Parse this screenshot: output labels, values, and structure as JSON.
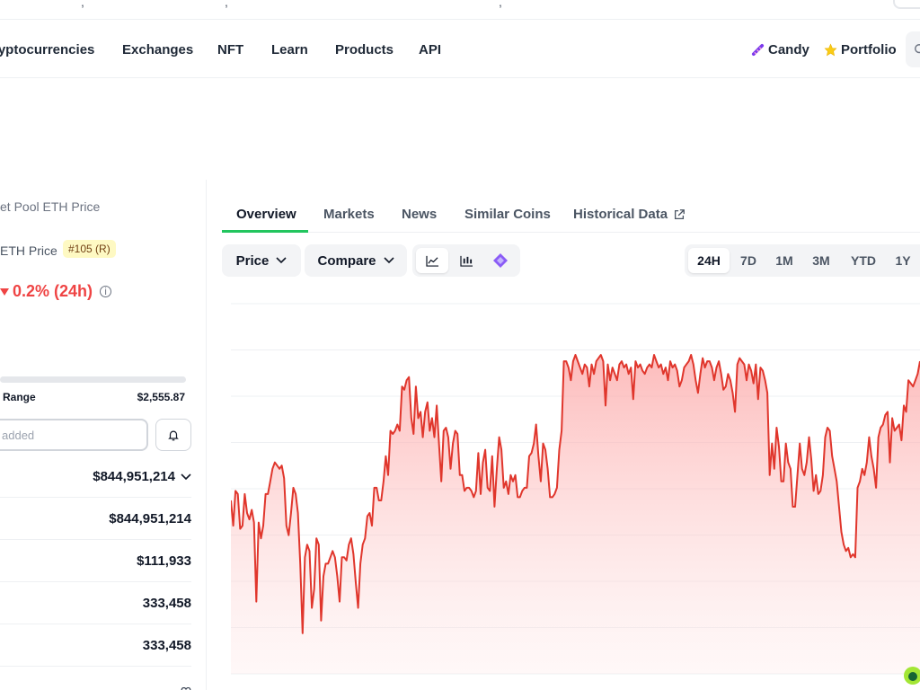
{
  "nav": {
    "items": [
      "ryptocurrencies",
      "Exchanges",
      "NFT",
      "Learn",
      "Products",
      "API"
    ],
    "candy": "Candy",
    "portfolio": "Portfolio"
  },
  "coin": {
    "title": "et Pool ETH Price",
    "price_label": "ETH Price",
    "rank": "#105 (R)",
    "change": "0.2% (24h)",
    "range_label": "Range",
    "range_value": "$2,555.87",
    "input_value": "added",
    "stats": [
      "$844,951,214",
      "$844,951,214",
      "$111,933",
      "333,458",
      "333,458"
    ]
  },
  "tabs": [
    "Overview",
    "Markets",
    "News",
    "Similar Coins",
    "Historical Data"
  ],
  "toolbar": {
    "price": "Price",
    "compare": "Compare"
  },
  "ranges": [
    "24H",
    "7D",
    "1M",
    "3M",
    "YTD",
    "1Y"
  ],
  "colors": {
    "accent_green": "#22c55e",
    "down_red": "#ef4444",
    "line_red": "#e0362c",
    "rank_bg": "#fef9c3"
  },
  "icons": {
    "candy": "candy-icon",
    "portfolio": "star-icon",
    "search": "search-icon",
    "bell": "bell-icon",
    "external": "external-link-icon",
    "chevron": "chevron-down-icon"
  },
  "chart_data": {
    "type": "area",
    "title": "",
    "xlabel": "",
    "ylabel": "",
    "grid": true,
    "ylim": [
      0,
      100
    ],
    "series": [
      {
        "values": [
          52,
          44,
          55,
          54,
          43,
          44,
          54,
          48,
          46,
          49,
          45,
          20,
          45,
          40,
          44,
          54,
          54,
          58,
          62,
          64,
          63,
          62,
          63,
          59,
          44,
          41,
          48,
          56,
          54,
          48,
          32,
          10,
          34,
          38,
          36,
          18,
          24,
          40,
          38,
          14,
          28,
          32,
          32,
          34,
          36,
          34,
          28,
          20,
          34,
          34,
          33,
          38,
          40,
          35,
          26,
          18,
          32,
          38,
          40,
          47,
          48,
          44,
          56,
          56,
          52,
          52,
          58,
          66,
          60,
          74,
          73,
          74,
          76,
          74,
          88,
          87,
          90,
          91,
          78,
          73,
          88,
          78,
          80,
          72,
          80,
          83,
          74,
          78,
          72,
          82,
          70,
          58,
          74,
          75,
          72,
          62,
          70,
          74,
          73,
          60,
          60,
          55,
          56,
          56,
          55,
          53,
          55,
          67,
          54,
          64,
          68,
          56,
          55,
          66,
          50,
          62,
          72,
          68,
          56,
          58,
          54,
          60,
          58,
          60,
          53,
          53,
          55,
          56,
          56,
          66,
          67,
          70,
          76,
          66,
          58,
          70,
          68,
          62,
          53,
          53,
          54,
          56,
          68,
          74,
          96,
          96,
          94,
          90,
          96,
          98,
          96,
          94,
          92,
          95,
          94,
          88,
          95,
          92,
          96,
          97,
          98,
          96,
          82,
          95,
          90,
          94,
          92,
          90,
          95,
          96,
          94,
          95,
          92,
          94,
          84,
          96,
          94,
          95,
          93,
          92,
          94,
          95,
          94,
          98,
          96,
          94,
          95,
          92,
          94,
          90,
          96,
          94,
          95,
          93,
          88,
          90,
          94,
          95,
          96,
          98,
          95,
          90,
          86,
          92,
          97,
          94,
          96,
          96,
          94,
          90,
          94,
          96,
          92,
          87,
          88,
          92,
          90,
          86,
          80,
          95,
          97,
          96,
          95,
          90,
          95,
          93,
          89,
          95,
          84,
          94,
          93,
          90,
          86,
          60,
          70,
          62,
          75,
          69,
          58,
          58,
          70,
          64,
          62,
          50,
          50,
          60,
          70,
          62,
          60,
          64,
          72,
          65,
          55,
          60,
          54,
          55,
          60,
          72,
          75,
          74,
          66,
          62,
          58,
          50,
          42,
          38,
          36,
          37,
          34,
          35,
          34,
          56,
          58,
          62,
          60,
          64,
          72,
          66,
          62,
          56,
          72,
          75,
          76,
          79,
          80,
          64,
          78,
          74,
          75,
          76,
          71,
          82,
          80,
          90,
          89,
          88,
          90,
          92,
          96
        ]
      }
    ]
  }
}
